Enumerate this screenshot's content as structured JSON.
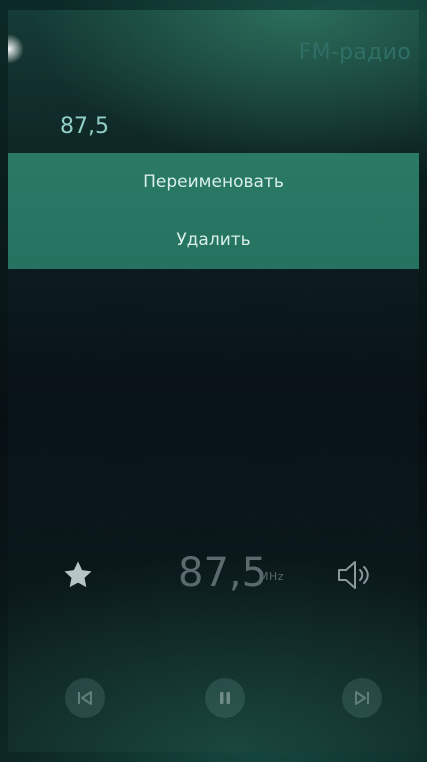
{
  "header": {
    "title": "FM-радио"
  },
  "station": {
    "name": "87,5"
  },
  "context_menu": {
    "items": [
      {
        "label": "Переименовать"
      },
      {
        "label": "Удалить"
      }
    ]
  },
  "player": {
    "frequency": "87,5",
    "unit": "MHz",
    "favorite_icon": "star-icon",
    "volume_icon": "speaker-icon"
  },
  "transport": {
    "previous_icon": "skip-previous-icon",
    "pause_icon": "pause-icon",
    "next_icon": "skip-next-icon"
  },
  "colors": {
    "menu_background": "#2a7a66",
    "title": "#2f6f66",
    "station_text": "#8fcfc4",
    "inactive_text": "#5b6a6c"
  }
}
